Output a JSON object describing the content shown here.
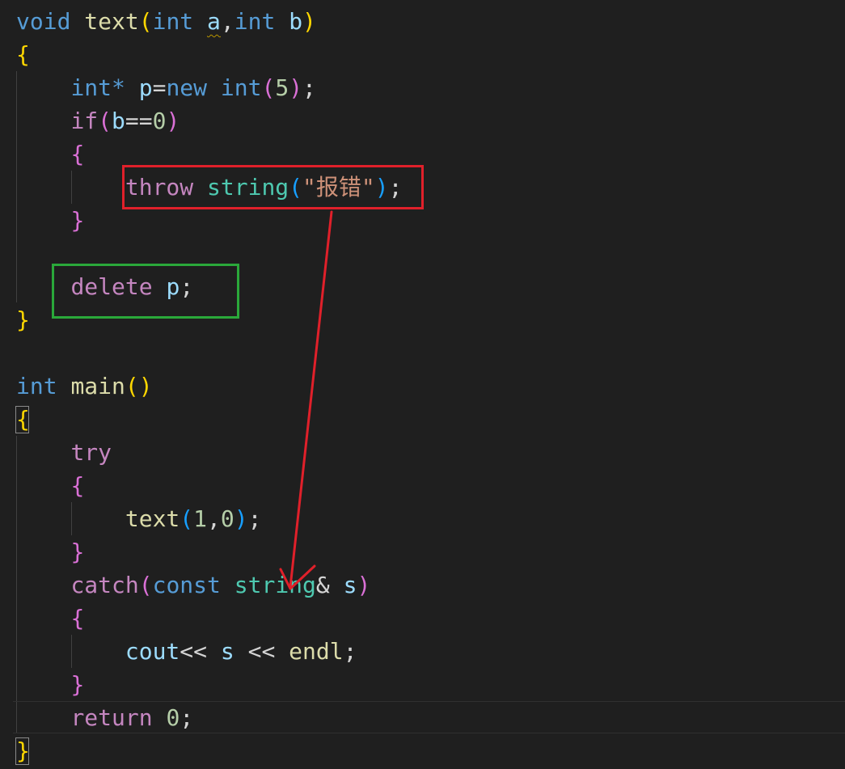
{
  "code": {
    "line1": {
      "kw_void": "void",
      "fn_text": "text",
      "open": "(",
      "kw_int1": "int",
      "param_a": "a",
      "comma": ",",
      "kw_int2": "int",
      "param_b": "b",
      "close": ")"
    },
    "line2": {
      "brace": "{"
    },
    "line3": {
      "kw_int": "int",
      "star": "*",
      "var_p": "p",
      "eq": "=",
      "kw_new": "new",
      "kw_int2": "int",
      "open": "(",
      "num": "5",
      "close": ")",
      "semi": ";"
    },
    "line4": {
      "kw_if": "if",
      "open": "(",
      "var_b": "b",
      "op": "==",
      "num": "0",
      "close": ")"
    },
    "line5": {
      "brace": "{"
    },
    "line6": {
      "kw_throw": "throw",
      "type_string": "string",
      "open": "(",
      "str": "\"报错\"",
      "close": ")",
      "semi": ";"
    },
    "line7": {
      "brace": "}"
    },
    "line9": {
      "kw_delete": "delete",
      "var_p": "p",
      "semi": ";"
    },
    "line10": {
      "brace": "}"
    },
    "line12": {
      "kw_int": "int",
      "fn_main": "main",
      "parens": "()"
    },
    "line13": {
      "brace": "{"
    },
    "line14": {
      "kw_try": "try"
    },
    "line15": {
      "brace": "{"
    },
    "line16": {
      "fn_text": "text",
      "open": "(",
      "num1": "1",
      "comma": ",",
      "num2": "0",
      "close": ")",
      "semi": ";"
    },
    "line17": {
      "brace": "}"
    },
    "line18": {
      "kw_catch": "catch",
      "open": "(",
      "kw_const": "const",
      "type_string": "string",
      "amp": "&",
      "var_s": "s",
      "close": ")"
    },
    "line19": {
      "brace": "{"
    },
    "line20": {
      "var_cout": "cout",
      "op1": "<<",
      "var_s": "s",
      "op2": "<<",
      "fn_endl": "endl",
      "semi": ";"
    },
    "line21": {
      "brace": "}"
    },
    "line22": {
      "kw_return": "return",
      "num": "0",
      "semi": ";"
    },
    "line23": {
      "brace": "}"
    }
  },
  "annotations": {
    "throw_box_color": "#e0202a",
    "delete_box_color": "#2aa83a",
    "arrow_color": "#e0202a"
  },
  "theme": {
    "background": "#1f1f1f",
    "keyword": "#569cd6",
    "control": "#c586c0",
    "function": "#dcdcaa",
    "type": "#4ec9b0",
    "variable": "#9cdcfe",
    "number": "#b5cea8",
    "string": "#ce9178"
  }
}
